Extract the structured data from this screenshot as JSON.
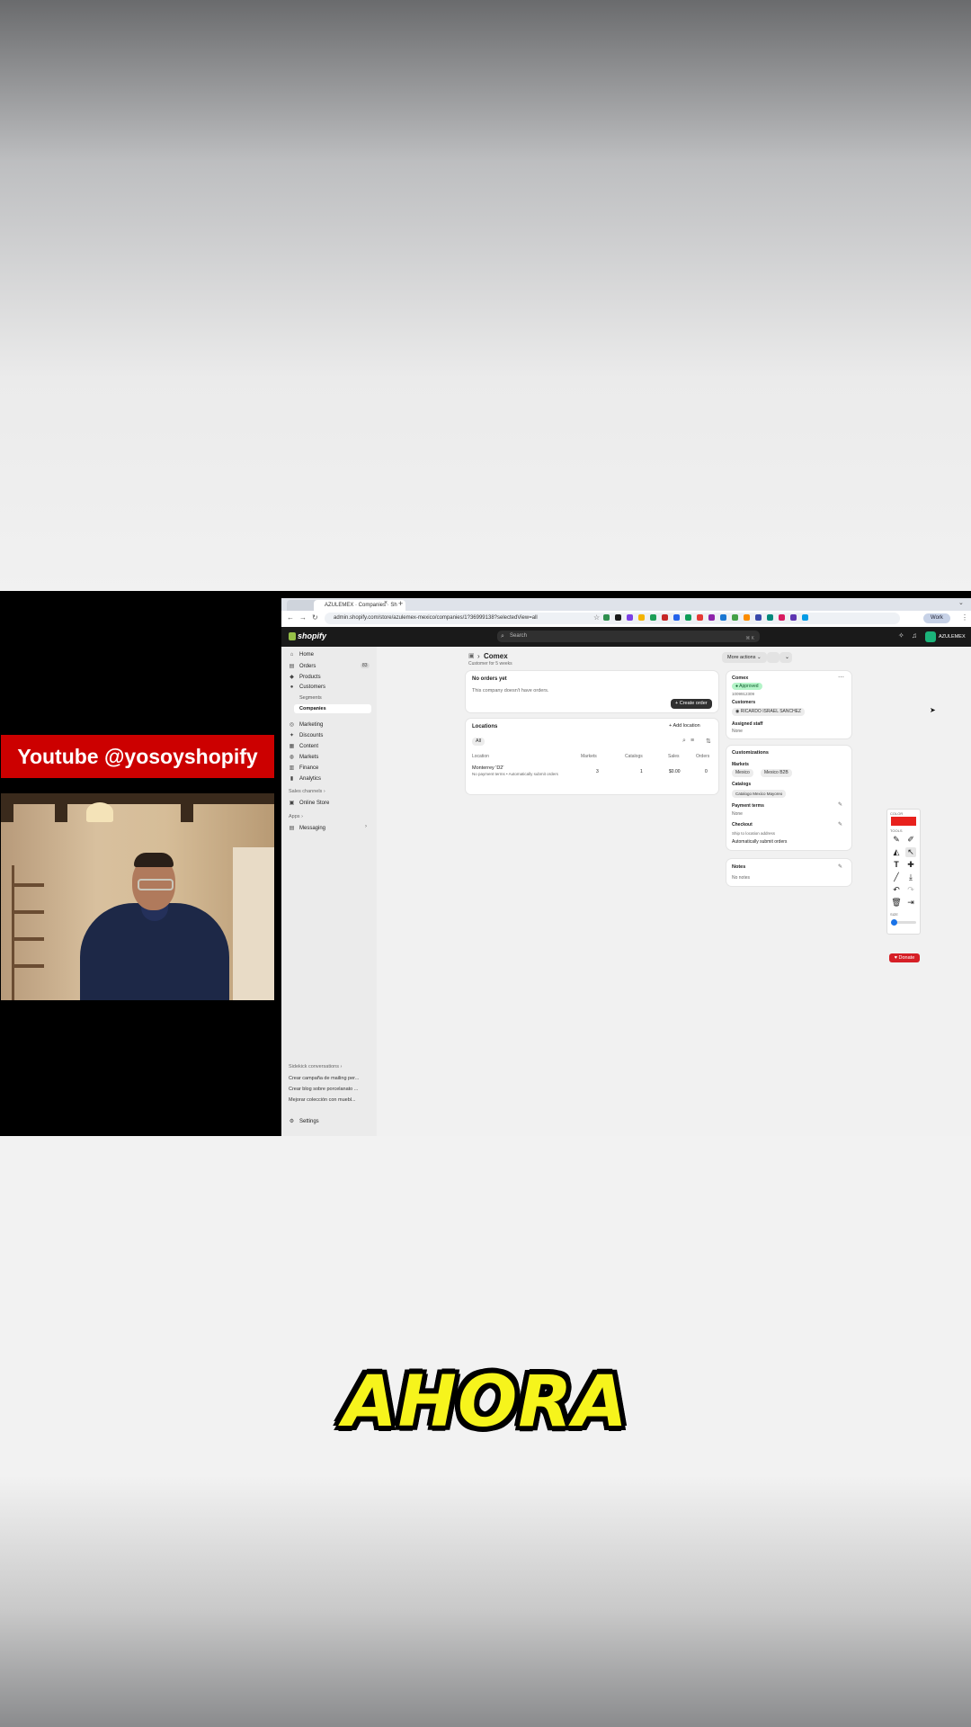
{
  "overlay": {
    "banner": "Youtube @yosoyshopify",
    "caption": "AHORA"
  },
  "browser": {
    "tab_title": "AZULEMEX · Companies · Sh",
    "new_tab": "+",
    "url": "admin.shopify.com/store/azulemex-mexico/companies/1?36999138?selectedView=all",
    "profile": "Work",
    "extension_colors": [
      "#2f8f4e",
      "#1a1a1a",
      "#7b3fe4",
      "#f4b400",
      "#1d9e57",
      "#c62828",
      "#2563eb",
      "#0f9d58",
      "#e53935",
      "#8e24aa",
      "#1976d2",
      "#43a047",
      "#fb8c00",
      "#3949ab",
      "#00897b",
      "#d81b60",
      "#5e35b1",
      "#039be5"
    ]
  },
  "shopify": {
    "logo": "shopify",
    "search_placeholder": "Search",
    "search_shortcut": "⌘ K",
    "store_name": "AZULEMEX"
  },
  "sidebar": {
    "items": [
      {
        "label": "Home",
        "icon": "home-icon",
        "glyph": "⌂"
      },
      {
        "label": "Orders",
        "icon": "orders-icon",
        "glyph": "▤",
        "badge": "83"
      },
      {
        "label": "Products",
        "icon": "tag-icon",
        "glyph": "◆"
      },
      {
        "label": "Customers",
        "icon": "person-icon",
        "glyph": "●"
      }
    ],
    "sub_items": [
      "Segments",
      "Companies"
    ],
    "items2": [
      {
        "label": "Marketing",
        "icon": "target-icon",
        "glyph": "◎"
      },
      {
        "label": "Discounts",
        "icon": "discount-icon",
        "glyph": "✦"
      },
      {
        "label": "Content",
        "icon": "content-icon",
        "glyph": "▦"
      },
      {
        "label": "Markets",
        "icon": "globe-icon",
        "glyph": "◍"
      },
      {
        "label": "Finance",
        "icon": "bank-icon",
        "glyph": "▥"
      },
      {
        "label": "Analytics",
        "icon": "chart-icon",
        "glyph": "▮"
      }
    ],
    "sales_channels": "Sales channels",
    "online_store": "Online Store",
    "apps": "Apps",
    "messaging": "Messaging",
    "recent_header": "Sidekick conversations",
    "recent": [
      "Crear campaña de mailing per...",
      "Crear blog sobre porcelanato ...",
      "Mejorar colección con muebl..."
    ],
    "settings": "Settings"
  },
  "page": {
    "title": "Comex",
    "subtitle": "Customer for 5 weeks",
    "more_actions": "More actions",
    "orders_card": {
      "title": "No orders yet",
      "body": "This company doesn't have orders.",
      "button": "Create order"
    },
    "locations": {
      "title": "Locations",
      "add": "Add location",
      "filter_chip": "All",
      "headers": [
        "Location",
        "Markets",
        "Catalogs",
        "Sales",
        "Orders"
      ],
      "rows": [
        {
          "name": "Monterrey 'D2'",
          "detail": "No payment terms • Automatically submit orders",
          "markets": "3",
          "catalogs": "1",
          "sales": "$0.00",
          "orders": "0"
        }
      ]
    },
    "company_card": {
      "name": "Comex",
      "status": "Approved",
      "id": "1009912309",
      "customers_label": "Customers",
      "customer": "RICARDO ISRAEL SANCHEZ",
      "staff_label": "Assigned staff",
      "staff_value": "None"
    },
    "custom_card": {
      "title": "Customizations",
      "markets_label": "Markets",
      "markets": [
        "Mexico",
        "Mexico B2B"
      ],
      "catalogs_label": "Catalogs",
      "catalog": "Catalogo Mexico Mayoreo",
      "payment_label": "Payment terms",
      "payment_value": "None",
      "checkout_label": "Checkout",
      "checkout_1": "Ship to location address",
      "checkout_2": "Automatically submit orders"
    },
    "notes_card": {
      "title": "Notes",
      "value": "No notes"
    }
  },
  "annotate_tool": {
    "color_label": "COLOR",
    "tools_label": "TOOLS",
    "size_label": "SIZE",
    "color": "#e8211d",
    "donate": "Donate"
  }
}
